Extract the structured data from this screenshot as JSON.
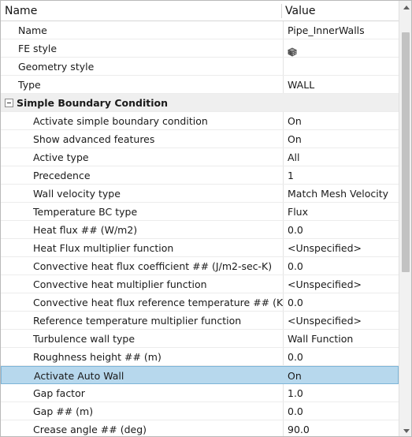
{
  "header": {
    "name_label": "Name",
    "value_label": "Value"
  },
  "top_rows": [
    {
      "name": "Name",
      "value": "Pipe_InnerWalls"
    },
    {
      "name": "FE style",
      "value_icon": "cube-icon"
    },
    {
      "name": "Geometry style",
      "value": ""
    },
    {
      "name": "Type",
      "value": "WALL"
    }
  ],
  "group": {
    "label": "Simple Boundary Condition",
    "expanded": true
  },
  "group_rows": [
    {
      "name": "Activate simple boundary condition",
      "value": "On"
    },
    {
      "name": "Show advanced features",
      "value": "On"
    },
    {
      "name": "Active type",
      "value": "All"
    },
    {
      "name": "Precedence",
      "value": "1"
    },
    {
      "name": "Wall velocity type",
      "value": "Match Mesh Velocity"
    },
    {
      "name": "Temperature BC type",
      "value": "Flux"
    },
    {
      "name": "Heat flux ## (W/m2)",
      "value": "0.0"
    },
    {
      "name": "Heat Flux multiplier function",
      "value": "<Unspecified>"
    },
    {
      "name": "Convective heat flux coefficient ## (J/m2-sec-K)",
      "value": "0.0"
    },
    {
      "name": "Convective heat multiplier function",
      "value": "<Unspecified>"
    },
    {
      "name": "Convective heat flux reference temperature ## (K)",
      "value": "0.0"
    },
    {
      "name": "Reference temperature multiplier function",
      "value": "<Unspecified>"
    },
    {
      "name": "Turbulence wall type",
      "value": "Wall Function"
    },
    {
      "name": "Roughness height ## (m)",
      "value": "0.0"
    },
    {
      "name": "Activate Auto Wall",
      "value": "On",
      "selected": true
    },
    {
      "name": "Gap factor",
      "value": "1.0"
    },
    {
      "name": "Gap ## (m)",
      "value": "0.0"
    },
    {
      "name": "Crease angle ## (deg)",
      "value": "90.0"
    }
  ],
  "colors": {
    "selection": "#b7d8ed",
    "group_background": "#efefef"
  }
}
